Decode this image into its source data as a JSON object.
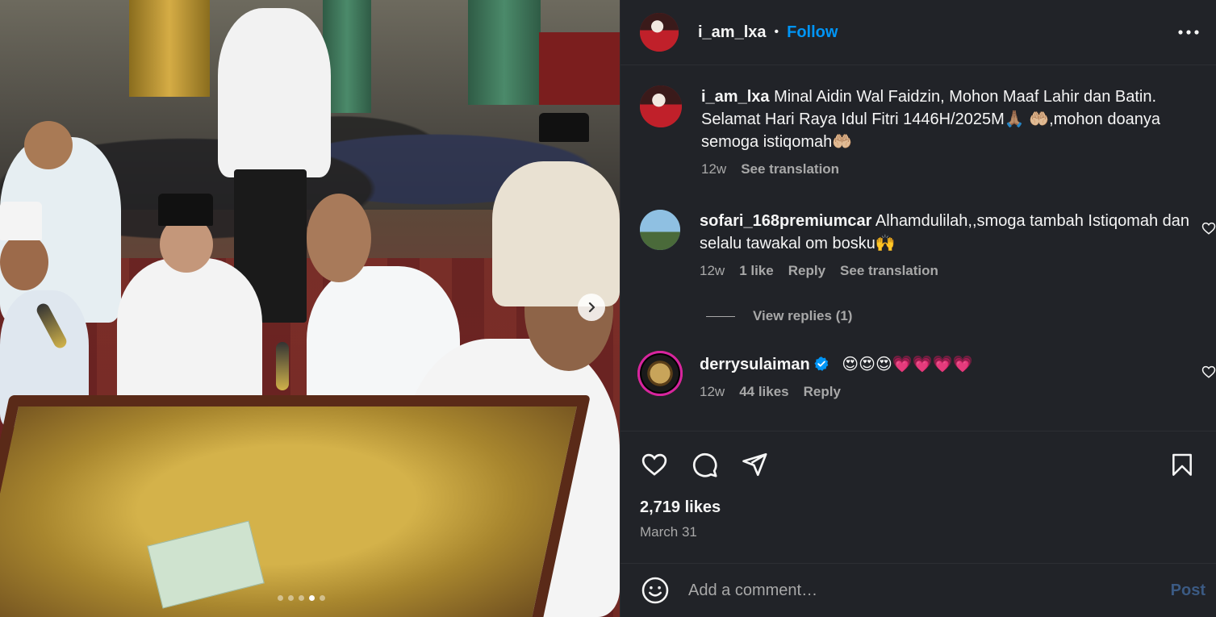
{
  "post": {
    "username": "i_am_lxa",
    "separator": "•",
    "follow_label": "Follow",
    "caption_text": "Minal Aidin Wal Faidzin, Mohon Maaf Lahir dan Batin. Selamat Hari Raya Idul Fitri 1446H/2025M🙏🏽 🤲🏼,mohon doanya semoga istiqomah🤲🏼",
    "caption_time": "12w",
    "caption_translate": "See translation",
    "carousel_dots": 5,
    "carousel_active": 3
  },
  "comments": [
    {
      "username": "sofari_168premiumcar",
      "text": "Alhamdulilah,,smoga tambah Istiqomah dan selalu tawakal om bosku🙌",
      "time": "12w",
      "likes": "1 like",
      "reply": "Reply",
      "translate": "See translation",
      "view_replies": "View replies (1)"
    },
    {
      "username": "derrysulaiman",
      "verified": true,
      "text": "😍😍😍💗💗💗💗",
      "time": "12w",
      "likes": "44 likes",
      "reply": "Reply"
    }
  ],
  "footer": {
    "likes_count": "2,719 likes",
    "date": "March 31",
    "comment_placeholder": "Add a comment…",
    "post_label": "Post"
  },
  "icons": {
    "more": "more-horizontal-icon",
    "like": "heart-icon",
    "comment": "comment-icon",
    "share": "send-icon",
    "save": "bookmark-icon",
    "emoji": "emoji-icon",
    "next": "chevron-right-icon"
  },
  "colors": {
    "panel_bg": "#212328",
    "link_blue": "#0095f6",
    "muted_text": "#a8a8a8",
    "post_disabled": "#3b5a83"
  }
}
